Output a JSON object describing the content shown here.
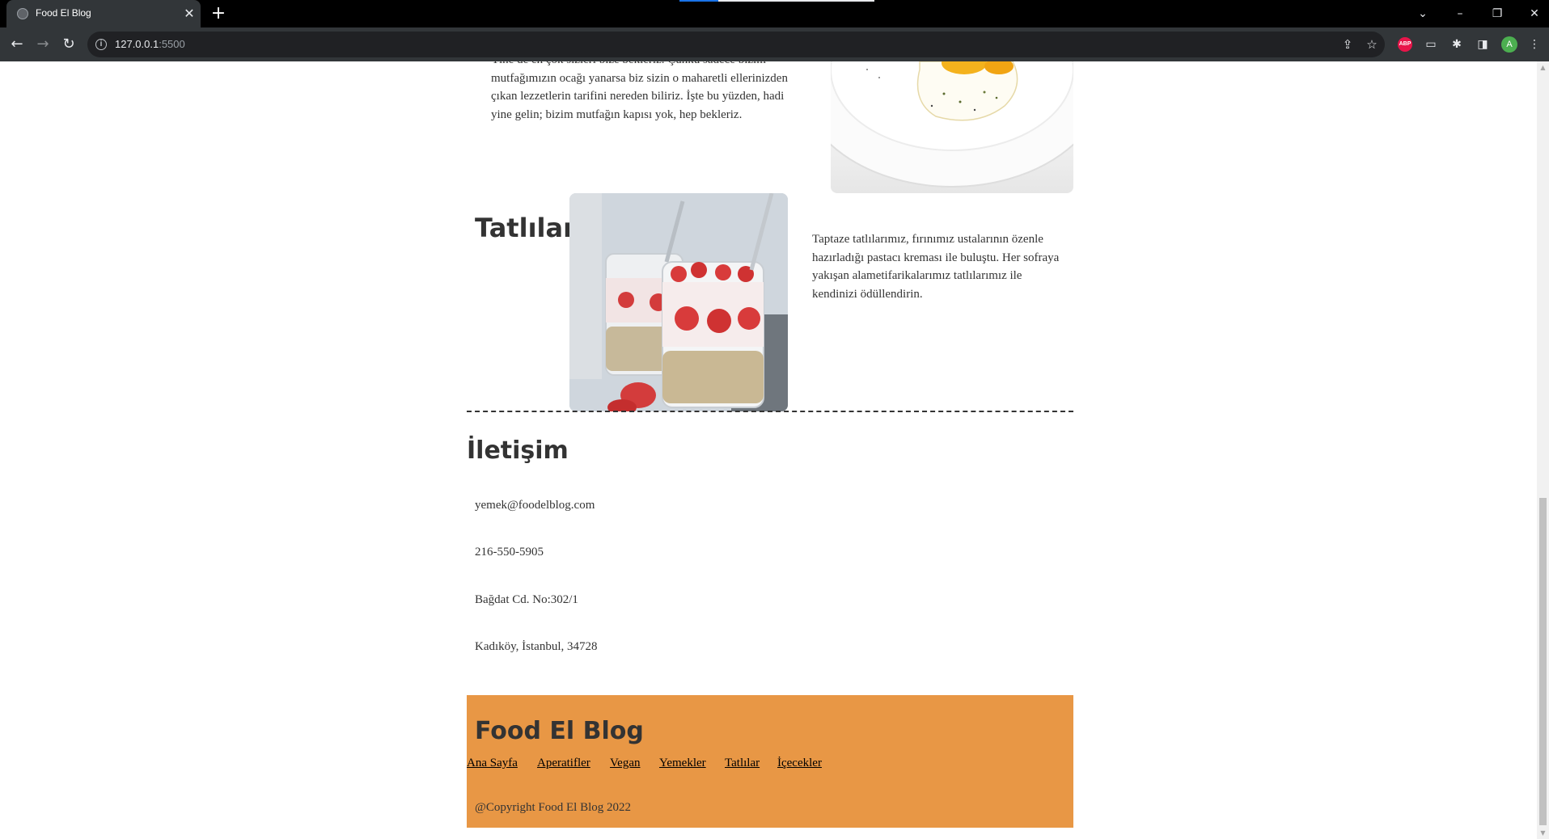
{
  "browser": {
    "tab_title": "Food El Blog",
    "tab_close": "✕",
    "new_tab": "+",
    "url_host": "127.0.0.1",
    "url_port": ":5500",
    "profile_initial": "A",
    "abp_label": "ABP",
    "icons": {
      "back": "←",
      "forward": "→",
      "reload": "↻",
      "info": "i",
      "share": "⇪",
      "star": "☆",
      "extensions": "✱",
      "side_panel": "◨",
      "menu": "⋮",
      "tab_search": "⌄",
      "minimize": "–",
      "restore": "❐",
      "close_window": "✕"
    }
  },
  "intro_paragraph": "Yine de en çok sizleri bize bekleriz. Çünkü sadece bizim mutfağımızın ocağı yanarsa biz sizin o maharetli ellerinizden çıkan lezzetlerin tarifini nereden biliriz. İşte bu yüzden, hadi yine gelin; bizim mutfağın kapısı yok, hep bekleriz.",
  "desserts": {
    "title": "Tatlılar",
    "text": "Taptaze tatlılarımız, fırınımız ustalarının özenle hazırladığı pastacı kreması ile buluştu. Her sofraya yakışan alametifarikalarımız tatlılarımız ile kendinizi ödüllendirin."
  },
  "contact": {
    "title": "İletişim",
    "email": "yemek@foodelblog.com",
    "phone": "216-550-5905",
    "address_line1": "Bağdat Cd. No:302/1",
    "address_line2": "Kadıköy, İstanbul, 34728"
  },
  "footer": {
    "title": "Food El Blog",
    "links": [
      "Ana Sayfa",
      "Aperatifler",
      "Vegan",
      "Yemekler",
      "Tatlılar",
      "İçecekler"
    ],
    "copyright": "@Copyright Food El Blog 2022"
  }
}
